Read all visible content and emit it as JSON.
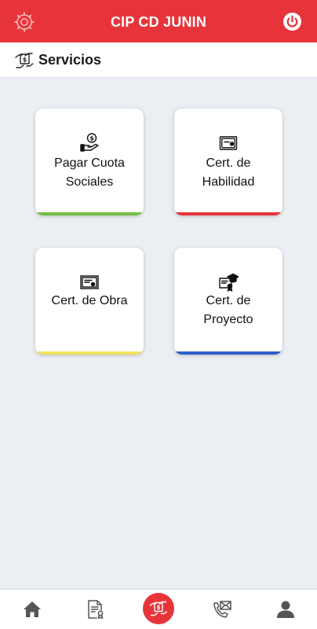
{
  "header": {
    "title": "CIP CD JUNIN",
    "left_icon": "gear-icon",
    "right_icon": "power-icon",
    "background": "#e7343a"
  },
  "section": {
    "title": "Servicios",
    "icon": "hand-money-icon"
  },
  "cards": [
    {
      "label_line1": "Pagar Cuota",
      "label_line2": "Sociales",
      "icon": "hand-coin-icon",
      "accent": "#72c043"
    },
    {
      "label_line1": "Cert. de",
      "label_line2": "Habilidad",
      "icon": "certificate-icon",
      "accent": "#e7343a"
    },
    {
      "label_line1": "Cert. de Obra",
      "label_line2": "",
      "icon": "diploma-icon",
      "accent": "#f3e35e"
    },
    {
      "label_line1": "Cert. de",
      "label_line2": "Proyecto",
      "icon": "graduation-certificate-icon",
      "accent": "#2e5fc9"
    }
  ],
  "bottom_nav": [
    {
      "icon": "home-icon",
      "active": false
    },
    {
      "icon": "document-icon",
      "active": false
    },
    {
      "icon": "hand-money-icon",
      "active": true
    },
    {
      "icon": "phone-mail-icon",
      "active": false
    },
    {
      "icon": "user-icon",
      "active": false
    }
  ]
}
